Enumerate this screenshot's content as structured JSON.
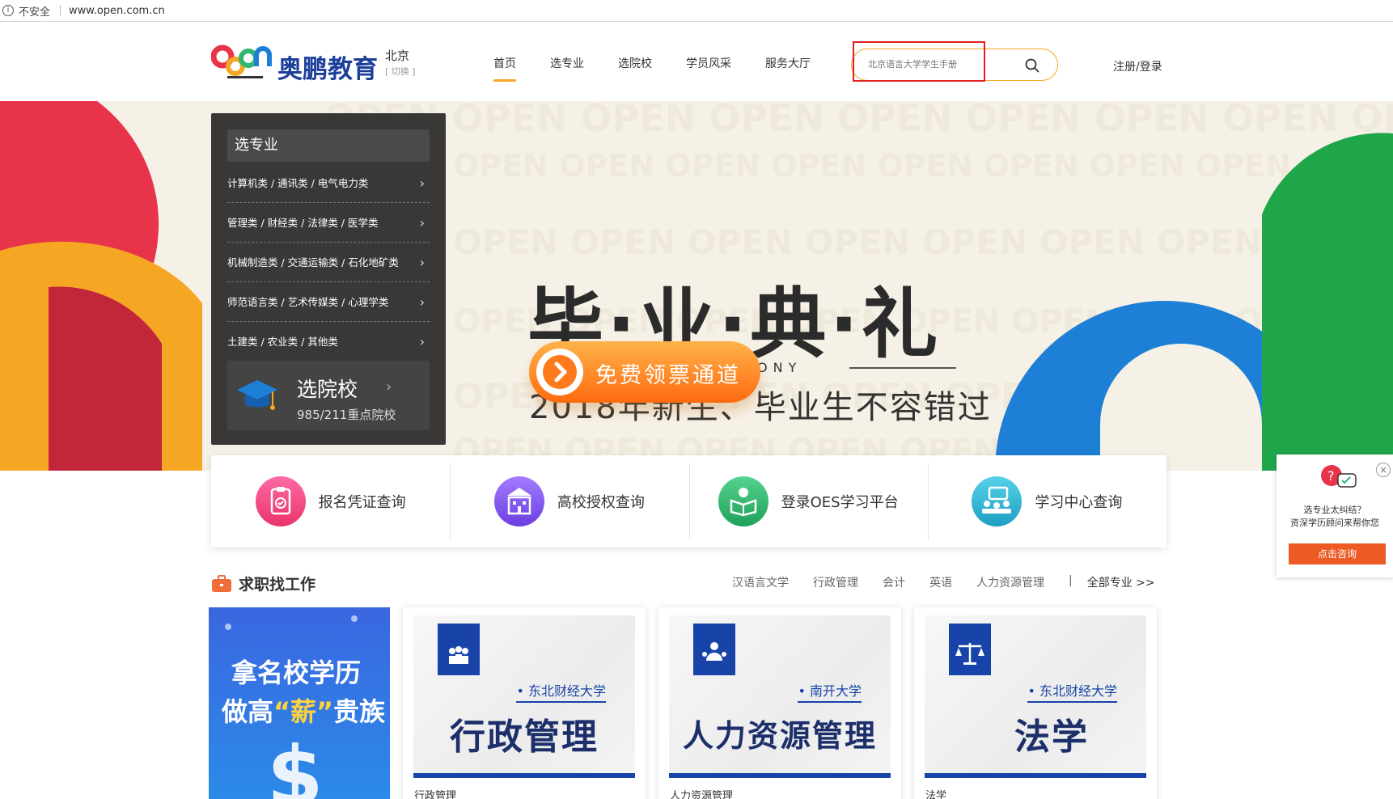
{
  "address_bar": {
    "security": "不安全",
    "url": "www.open.com.cn"
  },
  "header": {
    "brand": "奥鹏教育",
    "city": "北京",
    "city_switch": "[ 切换 ]",
    "nav": [
      {
        "label": "首页"
      },
      {
        "label": "选专业"
      },
      {
        "label": "选院校"
      },
      {
        "label": "学员风采"
      },
      {
        "label": "服务大厅"
      }
    ],
    "search_placeholder": "北京语言大学学生手册",
    "login": "注册/登录"
  },
  "banner": {
    "title": "毕·业·典·礼",
    "subtitle_en": "GRADUATION CEREMONY",
    "subtitle_cn": "2018年新生、毕业生不容错过",
    "button": "免费领票通道"
  },
  "category_panel": {
    "heading": "选专业",
    "rows": [
      "计算机类 / 通讯类 / 电气电力类",
      "管理类 / 财经类 / 法律类 / 医学类",
      "机械制造类 / 交通运输类 / 石化地矿类",
      "师范语言类 / 艺术传媒类 / 心理学类",
      "土建类 / 农业类 / 其他类"
    ],
    "school_title": "选院校",
    "school_sub": "985/211重点院校"
  },
  "quick_links": [
    {
      "label": "报名凭证查询",
      "color": "#f0468a"
    },
    {
      "label": "高校授权查询",
      "color": "#8b5cf0"
    },
    {
      "label": "登录OES学习平台",
      "color": "#2fb874"
    },
    {
      "label": "学习中心查询",
      "color": "#26b5d6"
    }
  ],
  "consult": {
    "line1": "选专业太纠结？",
    "line2": "资深学历顾问来帮你您",
    "button": "点击咨询"
  },
  "jobs": {
    "title": "求职找工作",
    "tags": [
      "汉语言文学",
      "行政管理",
      "会计",
      "英语",
      "人力资源管理"
    ],
    "divider": "|",
    "all": "全部专业 >>",
    "promo_line1": "拿名校学历",
    "promo_line2_a": "做高",
    "promo_line2_hl": "“薪”",
    "promo_line2_b": "贵族",
    "promo_symbol": "$",
    "courses": [
      {
        "uni": "• 东北财经大学",
        "big": "行政管理",
        "caption": "行政管理",
        "icon": "people-icon"
      },
      {
        "uni": "• 南开大学",
        "big": "人力资源管理",
        "caption": "人力资源管理",
        "icon": "team-icon"
      },
      {
        "uni": "• 东北财经大学",
        "big": "法学",
        "caption": "法学",
        "icon": "scales-icon"
      }
    ]
  },
  "colors": {
    "accent": "#f5a623",
    "brand_blue": "#1843a8",
    "cta": "#ff6a10"
  }
}
